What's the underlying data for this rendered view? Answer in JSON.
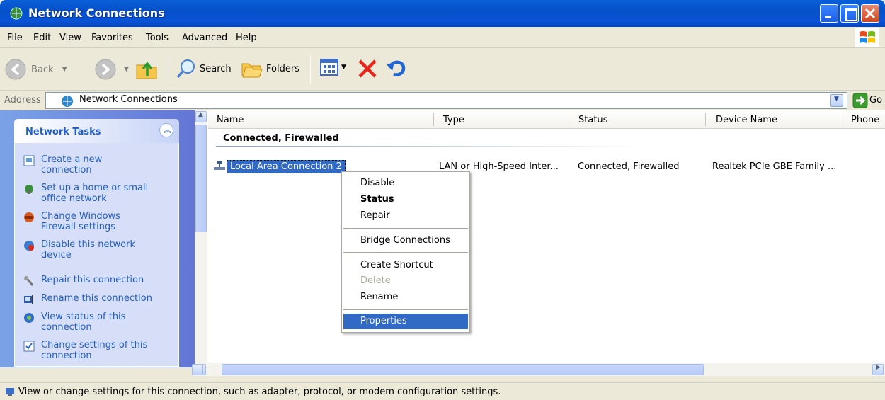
{
  "window": {
    "title": "Network Connections"
  },
  "menubar": {
    "items": [
      "File",
      "Edit",
      "View",
      "Favorites",
      "Tools",
      "Advanced",
      "Help"
    ]
  },
  "toolbar": {
    "back_label": "Back",
    "search_label": "Search",
    "folders_label": "Folders"
  },
  "address": {
    "label": "Address",
    "value": "Network Connections",
    "go_label": "Go"
  },
  "tasks": {
    "title": "Network Tasks",
    "items": [
      {
        "label": "Create a new connection",
        "icon": "new-connection-icon"
      },
      {
        "label": "Set up a home or small office network",
        "icon": "home-network-icon"
      },
      {
        "label": "Change Windows Firewall settings",
        "icon": "firewall-icon"
      },
      {
        "label": "Disable this network device",
        "icon": "disable-device-icon"
      },
      {
        "label": "Repair this connection",
        "icon": "repair-icon"
      },
      {
        "label": "Rename this connection",
        "icon": "rename-icon"
      },
      {
        "label": "View status of this connection",
        "icon": "status-icon"
      },
      {
        "label": "Change settings of this connection",
        "icon": "settings-icon"
      }
    ]
  },
  "columns": [
    "Name",
    "Type",
    "Status",
    "Device Name",
    "Phone"
  ],
  "group": {
    "title": "Connected, Firewalled"
  },
  "connection": {
    "name": "Local Area Connection 2",
    "type": "LAN or High-Speed Inter...",
    "status": "Connected, Firewalled",
    "device": "Realtek PCIe GBE Family ..."
  },
  "context_menu": {
    "disable": "Disable",
    "status": "Status",
    "repair": "Repair",
    "bridge": "Bridge Connections",
    "shortcut": "Create Shortcut",
    "delete": "Delete",
    "rename": "Rename",
    "properties": "Properties"
  },
  "statusbar": {
    "text": "View or change settings for this connection, such as adapter, protocol, or modem configuration settings."
  }
}
